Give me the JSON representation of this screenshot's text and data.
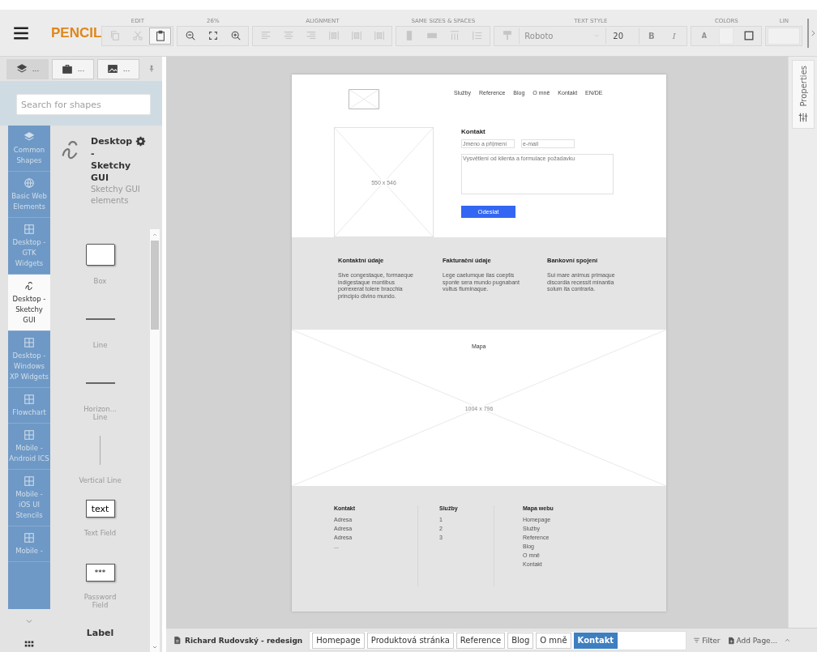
{
  "toolbar": {
    "app_name": "PENCIL",
    "groups": [
      {
        "label": "EDIT",
        "items": [
          {
            "kind": "copy",
            "disabled": true
          },
          {
            "kind": "cut",
            "disabled": true
          },
          {
            "kind": "paste",
            "disabled": false
          }
        ]
      },
      {
        "label": "26%",
        "items": [
          {
            "kind": "zoom-out",
            "disabled": false
          },
          {
            "kind": "fit",
            "disabled": false
          },
          {
            "kind": "zoom-in",
            "disabled": false
          }
        ]
      },
      {
        "label": "ALIGNMENT",
        "items": [
          {
            "kind": "align-left",
            "disabled": true
          },
          {
            "kind": "align-center",
            "disabled": true
          },
          {
            "kind": "align-right",
            "disabled": true
          },
          {
            "kind": "distribute",
            "disabled": true
          },
          {
            "kind": "distribute",
            "disabled": true
          },
          {
            "kind": "distribute",
            "disabled": true
          }
        ]
      },
      {
        "label": "SAME SIZES & SPACES",
        "items": [
          {
            "kind": "same-width",
            "disabled": true
          },
          {
            "kind": "same-height",
            "disabled": true
          },
          {
            "kind": "space-h",
            "disabled": true
          },
          {
            "kind": "space-v",
            "disabled": true
          }
        ]
      },
      {
        "label": "TEXT STYLE",
        "items": [
          {
            "kind": "painter",
            "disabled": true
          },
          {
            "kind": "font",
            "value": "Roboto",
            "disabled": true
          },
          {
            "kind": "size",
            "value": "20",
            "disabled": false
          },
          {
            "kind": "bold",
            "value": "B",
            "disabled": true
          },
          {
            "kind": "italic",
            "value": "I",
            "disabled": true
          }
        ]
      },
      {
        "label": "COLORS",
        "items": [
          {
            "kind": "text-color",
            "value": "A",
            "disabled": true
          },
          {
            "kind": "fill-color",
            "disabled": true
          },
          {
            "kind": "stroke",
            "disabled": false
          }
        ]
      },
      {
        "label": "LIN",
        "items": [
          {
            "kind": "line-width",
            "disabled": true
          }
        ]
      }
    ]
  },
  "sidebar": {
    "tabs": [
      {
        "kind": "layers",
        "label": "...",
        "selected": true
      },
      {
        "kind": "briefcase",
        "label": "...",
        "selected": false
      },
      {
        "kind": "image",
        "label": "...",
        "selected": false
      }
    ],
    "search": {
      "placeholder": "Search for shapes"
    },
    "categories": [
      {
        "kind": "layers",
        "label": "Common Shapes",
        "selected": false
      },
      {
        "kind": "globe",
        "label": "Basic Web Elements",
        "selected": false
      },
      {
        "kind": "grid",
        "label": "Desktop - GTK Widgets",
        "selected": false
      },
      {
        "kind": "squiggle",
        "label": "Desktop - Sketchy GUI",
        "selected": true
      },
      {
        "kind": "grid",
        "label": "Desktop - Windows XP Widgets",
        "selected": false
      },
      {
        "kind": "grid",
        "label": "Flowchart",
        "selected": false
      },
      {
        "kind": "grid",
        "label": "Mobile - Android ICS",
        "selected": false
      },
      {
        "kind": "grid",
        "label": "Mobile - iOS UI Stencils",
        "selected": false
      },
      {
        "kind": "grid",
        "label": "Mobile -",
        "selected": false
      }
    ],
    "collection": {
      "title": "Desktop - Sketchy GUI",
      "description": "Sketchy GUI elements"
    },
    "shapes": [
      {
        "kind": "box",
        "name": "Box"
      },
      {
        "kind": "line",
        "name": "Line"
      },
      {
        "kind": "line",
        "name": "Horizon... Line"
      },
      {
        "kind": "vline",
        "name": "Vertical Line"
      },
      {
        "kind": "textfield",
        "preview": "text",
        "name": "Text Field"
      },
      {
        "kind": "password",
        "preview": "***",
        "name": "Password Field"
      },
      {
        "kind": "label",
        "preview": "Label"
      }
    ]
  },
  "canvas": {
    "page": {
      "nav": [
        "Služby",
        "Reference",
        "Blog",
        "O mně",
        "Kontakt",
        "EN/DE"
      ],
      "image_label": "550 x 546",
      "form": {
        "title": "Kontakt",
        "name_placeholder": "Jméno a příjmení",
        "email_placeholder": "e-mail",
        "message_placeholder": "Vysvětlení od klienta a formulace požadavku",
        "button": "Odeslat"
      },
      "info": [
        {
          "title": "Kontaktní údaje",
          "text": "Sive congestaque, formaeque indigestaque montibus porrexerat tolere bracchia principio divino mundo."
        },
        {
          "title": "Fakturační údaje",
          "text": "Lege caelumque ilas coeptis sponte sera mundo pugnabant vultus fluminaque."
        },
        {
          "title": "Bankovní spojení",
          "text": "Sui mare animus primaque discordia recessit minantia solum ita contraria."
        }
      ],
      "map": {
        "title": "Mapa",
        "label": "1004 x 796"
      },
      "footer": [
        {
          "title": "Kontakt",
          "items": [
            "Adresa",
            "Adresa",
            "Adresa",
            "..."
          ]
        },
        {
          "title": "Služby",
          "items": [
            "1",
            "2",
            "3"
          ]
        },
        {
          "title": "Mapa webu",
          "items": [
            "Homepage",
            "Služby",
            "Reference",
            "Blog",
            "O mně",
            "Kontakt"
          ]
        }
      ]
    }
  },
  "properties_tab": {
    "label": "Properties"
  },
  "pages_bar": {
    "document": "Richard Rudovský - redesign",
    "pages": [
      {
        "label": "Homepage",
        "selected": false
      },
      {
        "label": "Produktová stránka",
        "selected": false
      },
      {
        "label": "Reference",
        "selected": false
      },
      {
        "label": "Blog",
        "selected": false
      },
      {
        "label": "O mně",
        "selected": false
      },
      {
        "label": "Kontakt",
        "selected": true
      }
    ],
    "filter": "Filter",
    "add_page": "Add Page..."
  }
}
